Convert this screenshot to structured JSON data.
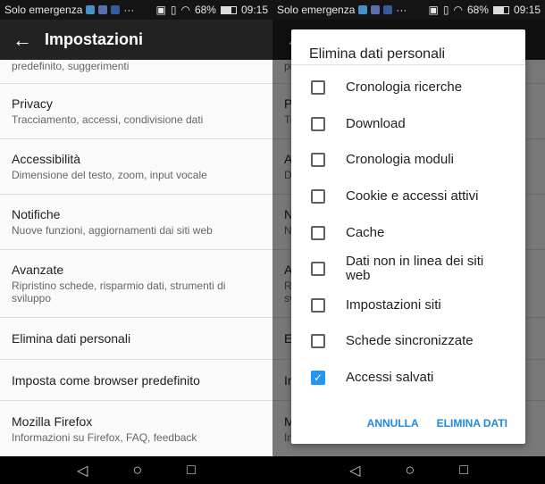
{
  "status": {
    "carrier": "Solo emergenza",
    "more": "···",
    "battery": "68%",
    "time": "09:15"
  },
  "appbar": {
    "title": "Impostazioni"
  },
  "settings": {
    "top_subtitle": "predefinito, suggerimenti",
    "items": [
      {
        "title": "Privacy",
        "subtitle": "Tracciamento, accessi, condivisione dati"
      },
      {
        "title": "Accessibilità",
        "subtitle": "Dimensione del testo, zoom, input vocale"
      },
      {
        "title": "Notifiche",
        "subtitle": "Nuove funzioni, aggiornamenti dai siti web"
      },
      {
        "title": "Avanzate",
        "subtitle": "Ripristino schede, risparmio dati, strumenti di sviluppo"
      },
      {
        "title": "Elimina dati personali"
      },
      {
        "title": "Imposta come browser predefinito"
      },
      {
        "title": "Mozilla Firefox",
        "subtitle": "Informazioni su Firefox, FAQ, feedback"
      }
    ]
  },
  "dialog": {
    "title": "Elimina dati personali",
    "options": [
      {
        "label": "Cronologia ricerche",
        "checked": false
      },
      {
        "label": "Download",
        "checked": false
      },
      {
        "label": "Cronologia moduli",
        "checked": false
      },
      {
        "label": "Cookie e accessi attivi",
        "checked": false
      },
      {
        "label": "Cache",
        "checked": false
      },
      {
        "label": "Dati non in linea dei siti web",
        "checked": false
      },
      {
        "label": "Impostazioni siti",
        "checked": false
      },
      {
        "label": "Schede sincronizzate",
        "checked": false
      },
      {
        "label": "Accessi salvati",
        "checked": true
      }
    ],
    "cancel": "ANNULLA",
    "confirm": "ELIMINA DATI"
  },
  "colors": {
    "accent": "#2196f3",
    "action": "#1e88e5"
  }
}
